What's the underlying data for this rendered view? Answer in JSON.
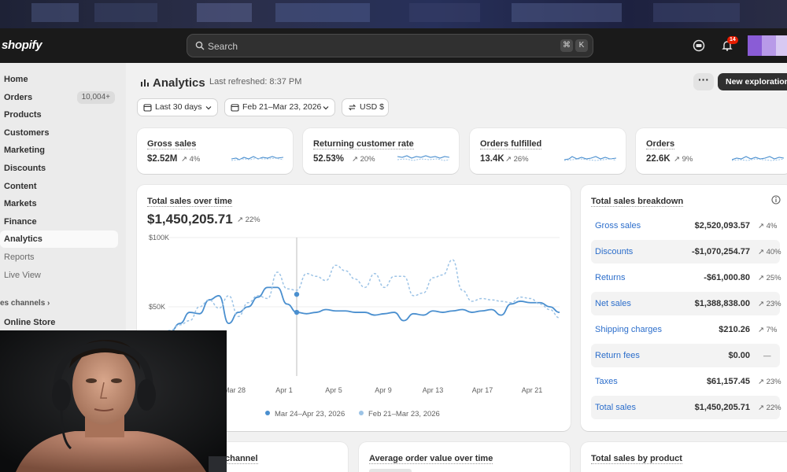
{
  "app": {
    "logo": "shopify"
  },
  "search": {
    "placeholder": "Search",
    "shortcut_1": "⌘",
    "shortcut_2": "K"
  },
  "topbar": {
    "notification_count": "14"
  },
  "sidebar": {
    "items": [
      {
        "label": "Home"
      },
      {
        "label": "Orders",
        "count": "10,004+"
      },
      {
        "label": "Products"
      },
      {
        "label": "Customers"
      },
      {
        "label": "Marketing"
      },
      {
        "label": "Discounts"
      },
      {
        "label": "Content"
      },
      {
        "label": "Markets"
      },
      {
        "label": "Finance"
      },
      {
        "label": "Analytics"
      },
      {
        "label": "Reports"
      },
      {
        "label": "Live View"
      }
    ],
    "section_label": "es channels",
    "online_store": "Online Store"
  },
  "header": {
    "title": "Analytics",
    "refreshed": "Last refreshed: 8:37 PM",
    "new_button": "New exploration"
  },
  "filters": {
    "range": "Last 30 days",
    "compare": "Feb 21–Mar 23, 2026",
    "currency": "USD $"
  },
  "metrics": [
    {
      "label": "Gross sales",
      "value": "$2.52M",
      "change": "↗ 4%"
    },
    {
      "label": "Returning customer rate",
      "value": "52.53%",
      "change": "↗ 20%"
    },
    {
      "label": "Orders fulfilled",
      "value": "13.4K",
      "change": "↗ 26%"
    },
    {
      "label": "Orders",
      "value": "22.6K",
      "change": "↗ 9%"
    }
  ],
  "sales_chart": {
    "title": "Total sales over time",
    "total": "$1,450,205.71",
    "change": "↗ 22%",
    "y_ticks": [
      "$100K",
      "$50K"
    ],
    "x_ticks": [
      "Mar 28",
      "Apr 1",
      "Apr 5",
      "Apr 9",
      "Apr 13",
      "Apr 17",
      "Apr 21"
    ],
    "legend_current": "Mar 24–Apr 23, 2026",
    "legend_previous": "Feb 21–Mar 23, 2026"
  },
  "breakdown": {
    "title": "Total sales breakdown",
    "rows": [
      {
        "label": "Gross sales",
        "value": "$2,520,093.57",
        "change": "↗ 4%"
      },
      {
        "label": "Discounts",
        "value": "-$1,070,254.77",
        "change": "↗ 40%"
      },
      {
        "label": "Returns",
        "value": "-$61,000.80",
        "change": "↗ 25%"
      },
      {
        "label": "Net sales",
        "value": "$1,388,838.00",
        "change": "↗ 23%"
      },
      {
        "label": "Shipping charges",
        "value": "$210.26",
        "change": "↗ 7%"
      },
      {
        "label": "Return fees",
        "value": "$0.00",
        "change": "—"
      },
      {
        "label": "Taxes",
        "value": "$61,157.45",
        "change": "↗ 23%"
      },
      {
        "label": "Total sales",
        "value": "$1,450,205.71",
        "change": "↗ 22%"
      }
    ]
  },
  "bottom_cards": {
    "channel": "channel",
    "aov": "Average order value over time",
    "by_product": "Total sales by product"
  },
  "chart_data": {
    "type": "line",
    "title": "Total sales over time",
    "ylim": [
      0,
      100000
    ],
    "y_ticks": [
      "$100K",
      "$50K"
    ],
    "x_ticks": [
      "Mar 28",
      "Apr 1",
      "Apr 5",
      "Apr 9",
      "Apr 13",
      "Apr 17",
      "Apr 21"
    ],
    "series": [
      {
        "name": "Mar 24–Apr 23, 2026",
        "color": "#4a8fcf",
        "values": [
          28000,
          32000,
          38000,
          46000,
          45000,
          55000,
          58000,
          38000,
          46000,
          50000,
          57000,
          64000,
          64000,
          52000,
          46000,
          45000,
          46000,
          48000,
          47000,
          47000,
          46000,
          46000,
          44000,
          45000,
          46000,
          40000,
          45000,
          44000,
          47000,
          46000,
          47000,
          48000,
          46000,
          47000,
          48000,
          44000,
          52000,
          54000,
          53000,
          53000,
          50000,
          46000
        ]
      },
      {
        "name": "Feb 21–Mar 23, 2026",
        "color": "#9cc3e6",
        "values": [
          30000,
          33000,
          37000,
          40000,
          50000,
          55000,
          49000,
          58000,
          43000,
          53000,
          58000,
          56000,
          75000,
          63000,
          62000,
          74000,
          72000,
          69000,
          80000,
          76000,
          70000,
          64000,
          74000,
          64000,
          72000,
          72000,
          58000,
          60000,
          71000,
          73000,
          84000,
          62000,
          54000,
          56000,
          55000,
          54000,
          53000,
          57000,
          56000,
          52000,
          48000,
          42000
        ]
      }
    ]
  }
}
